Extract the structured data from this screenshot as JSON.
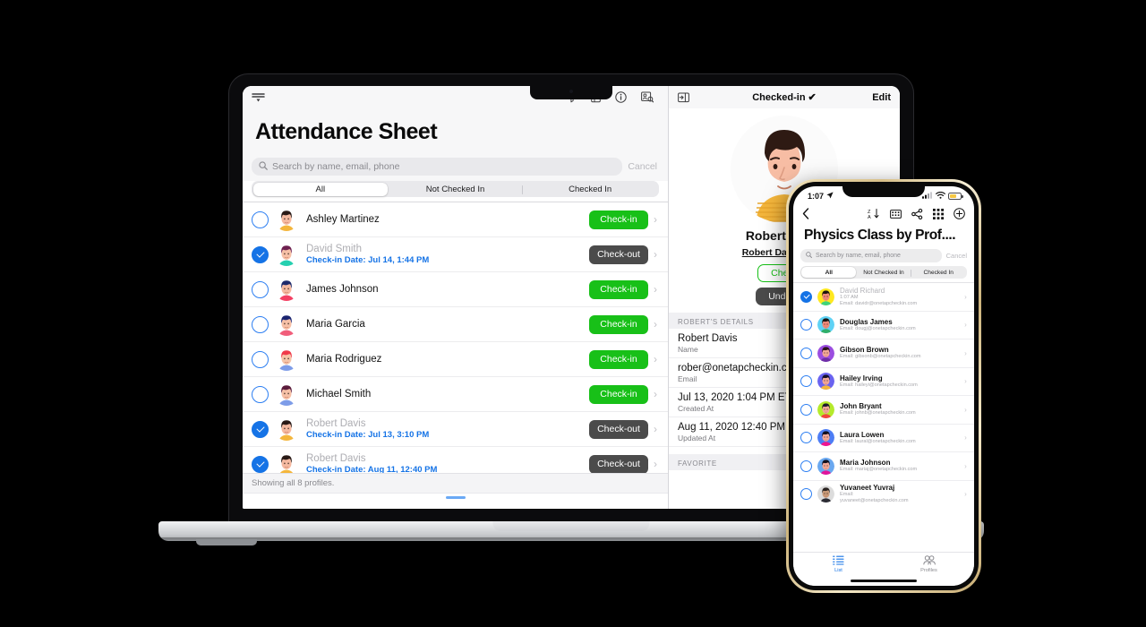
{
  "laptop": {
    "toolbar": {
      "icons": [
        "sidebar-toggle-icon",
        "filter-icon",
        "calendar-icon",
        "info-icon",
        "contacts-search-icon"
      ]
    },
    "page_title": "Attendance Sheet",
    "search": {
      "placeholder": "Search by name, email, phone",
      "cancel_label": "Cancel"
    },
    "segments": [
      {
        "label": "All",
        "selected": true
      },
      {
        "label": "Not Checked In",
        "selected": false
      },
      {
        "label": "Checked In",
        "selected": false
      }
    ],
    "rows": [
      {
        "name": "Ashley Martinez",
        "checked": false,
        "subtitle": "",
        "action": "Check-in",
        "action_style": "green",
        "hair": "#2a1a16",
        "skin": "#f5b9a0",
        "shirt": "#f4b63c",
        "bg": "#ffffff"
      },
      {
        "name": "David Smith",
        "checked": true,
        "subtitle": "Check-in Date: Jul 14, 1:44 PM",
        "action": "Check-out",
        "action_style": "gray",
        "hair": "#6e2050",
        "skin": "#f6c0a6",
        "shirt": "#25d0b0",
        "bg": "#ffffff"
      },
      {
        "name": "James Johnson",
        "checked": false,
        "subtitle": "",
        "action": "Check-in",
        "action_style": "green",
        "hair": "#1e2a6b",
        "skin": "#f5b9a0",
        "shirt": "#f44063",
        "bg": "#ffffff"
      },
      {
        "name": "Maria Garcia",
        "checked": false,
        "subtitle": "",
        "action": "Check-in",
        "action_style": "green",
        "hair": "#1b2470",
        "skin": "#f6c0a6",
        "shirt": "#f15d7a",
        "bg": "#ffffff"
      },
      {
        "name": "Maria Rodriguez",
        "checked": false,
        "subtitle": "",
        "action": "Check-in",
        "action_style": "green",
        "hair": "#f03a4a",
        "skin": "#f7c5a8",
        "shirt": "#7d9ce8",
        "bg": "#ffffff"
      },
      {
        "name": "Michael Smith",
        "checked": false,
        "subtitle": "",
        "action": "Check-in",
        "action_style": "green",
        "hair": "#5b1c3c",
        "skin": "#f6c0a6",
        "shirt": "#7d9ce8",
        "bg": "#ffffff"
      },
      {
        "name": "Robert Davis",
        "checked": true,
        "subtitle": "Check-in Date: Jul 13, 3:10 PM",
        "action": "Check-out",
        "action_style": "gray",
        "hair": "#2a1a16",
        "skin": "#f5b9a0",
        "shirt": "#f4b63c",
        "bg": "#ffffff"
      },
      {
        "name": "Robert Davis",
        "checked": true,
        "subtitle": "Check-in Date: Aug 11, 12:40 PM",
        "action": "Check-out",
        "action_style": "gray",
        "hair": "#2a1a16",
        "skin": "#f5b9a0",
        "shirt": "#f4b63c",
        "bg": "#ffffff"
      }
    ],
    "footer_note": "Showing all 8 profiles.",
    "detail": {
      "status_title": "Checked-in",
      "status_check": "✔",
      "edit_label": "Edit",
      "person_name": "Robert Davis",
      "checked_in_note": "Robert Davis has c",
      "primary_button": "Check",
      "secondary_button": "Undo C",
      "details_header": "Robert's Details",
      "fields": [
        {
          "value": "Robert Davis",
          "label": "Name"
        },
        {
          "value": "rober@onetapcheckin.co",
          "label": "Email"
        },
        {
          "value": "Jul 13, 2020 1:04 PM ET",
          "label": "Created At"
        },
        {
          "value": "Aug 11, 2020 12:40 PM E",
          "label": "Updated At"
        }
      ],
      "favorite_header": "Favorite"
    }
  },
  "phone": {
    "status": {
      "time": "1:07",
      "location_icon": "location-arrow-icon",
      "cellular": "cellular-icon",
      "wifi": "wifi-icon",
      "battery": "battery-icon",
      "battery_color": "#f6c846"
    },
    "nav_icons": [
      "back-chevron-icon",
      "sort-za-icon",
      "keypad-icon",
      "share-icon",
      "grid-icon",
      "plus-circle-icon"
    ],
    "title": "Physics Class by Prof....",
    "search": {
      "placeholder": "Search by name, email, phone",
      "cancel_label": "Cancel"
    },
    "segments": [
      {
        "label": "All",
        "selected": true
      },
      {
        "label": "Not Checked In",
        "selected": false
      },
      {
        "label": "Checked In",
        "selected": false
      }
    ],
    "rows": [
      {
        "name": "David Richard",
        "checked": true,
        "time": "1:07 AM",
        "email": "Email: davidr@onetapcheckin.com",
        "bg": "#ffe81f",
        "hair": "#1e1410",
        "skin": "#f08a7a",
        "shirt": "#3fd37a"
      },
      {
        "name": "Douglas James",
        "checked": false,
        "time": "",
        "email": "Email: dougj@onetapcheckin.com",
        "bg": "#5fd2f5",
        "hair": "#1e1410",
        "skin": "#f08a7a",
        "shirt": "#2fae6a"
      },
      {
        "name": "Gibson Brown",
        "checked": false,
        "time": "",
        "email": "Email: gibsonb@onetapcheckin.com",
        "bg": "#9b4de0",
        "hair": "#2a1218",
        "skin": "#f3a898",
        "shirt": "#6e2fa8"
      },
      {
        "name": "Hailey Irving",
        "checked": false,
        "time": "",
        "email": "Email: haileyi@onetapcheckin.com",
        "bg": "#6a63f0",
        "hair": "#141028",
        "skin": "#f3a898",
        "shirt": "#f4b63c"
      },
      {
        "name": "John Bryant",
        "checked": false,
        "time": "",
        "email": "Email: johnb@onetapcheckin.com",
        "bg": "#b5ea2b",
        "hair": "#1e1a2e",
        "skin": "#f3a898",
        "shirt": "#f2453d"
      },
      {
        "name": "Laura Lowen",
        "checked": false,
        "time": "",
        "email": "Email: laural@onetapcheckin.com",
        "bg": "#4d7df5",
        "hair": "#120f1e",
        "skin": "#f3a898",
        "shirt": "#f0148f"
      },
      {
        "name": "Maria Johnson",
        "checked": false,
        "time": "",
        "email": "Email: mariaj@onetapcheckin.com",
        "bg": "#6aa8f0",
        "hair": "#120f1e",
        "skin": "#f3a898",
        "shirt": "#e0149b"
      },
      {
        "name": "Yuvaneet Yuvraj",
        "checked": false,
        "time": "",
        "email": "Email:\nyuvaneet@onetapcheckin.com",
        "bg": "#dcdcdc",
        "hair": "#2a2320",
        "skin": "#c99a78",
        "shirt": "#2b2b33"
      }
    ],
    "tabs": [
      {
        "label": "List",
        "icon": "list-icon",
        "active": true,
        "color": "#1573e6"
      },
      {
        "label": "Profiles",
        "icon": "profiles-icon",
        "active": false,
        "color": "#8a8a8f"
      }
    ]
  },
  "colors": {
    "accent_blue": "#1573e6",
    "green": "#18c018",
    "gray_btn": "#4b4b4b",
    "canvas": "#000000"
  }
}
